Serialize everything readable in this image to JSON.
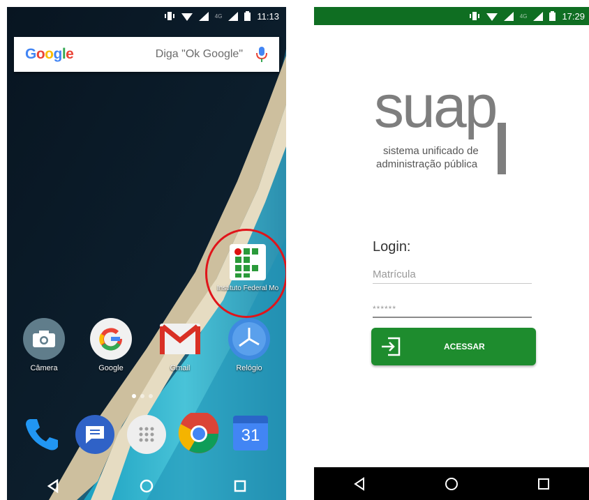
{
  "home_screen": {
    "status_bar": {
      "time": "11:13",
      "network": "4G"
    },
    "search_bar": {
      "logo_letters": [
        "G",
        "o",
        "o",
        "g",
        "l",
        "e"
      ],
      "hint": "Diga \"Ok Google\"",
      "icon": "mic-icon"
    },
    "highlighted_app": {
      "label": "Instituto Federal Mo",
      "icon": "ifrn-logo-icon",
      "ring_color": "#e0141a"
    },
    "dock_row": [
      {
        "label": "Câmera",
        "icon": "camera-icon"
      },
      {
        "label": "Google",
        "icon": "google-icon"
      },
      {
        "label": "Gmail",
        "icon": "gmail-icon"
      },
      {
        "label": "Relógio",
        "icon": "clock-icon"
      }
    ],
    "hotseat": [
      {
        "icon": "phone-icon"
      },
      {
        "icon": "messages-icon"
      },
      {
        "icon": "app-drawer-icon"
      },
      {
        "icon": "chrome-icon"
      },
      {
        "icon": "calendar-icon",
        "text": "31"
      }
    ],
    "nav_icons": [
      "back-icon",
      "home-icon",
      "recents-icon"
    ]
  },
  "login_screen": {
    "status_bar": {
      "time": "17:29",
      "network": "4G",
      "color": "#0f6e22"
    },
    "logo": {
      "word": "suap",
      "subtitle_line1": "sistema unificado de",
      "subtitle_line2": "administração pública"
    },
    "login_title": "Login:",
    "username": {
      "placeholder": "Matrícula"
    },
    "password": {
      "value": "******"
    },
    "submit_button": {
      "label": "ACESSAR",
      "color": "#1e8c2e",
      "icon": "login-arrow-icon"
    },
    "nav_icons": [
      "back-icon",
      "home-icon",
      "recents-icon"
    ]
  }
}
